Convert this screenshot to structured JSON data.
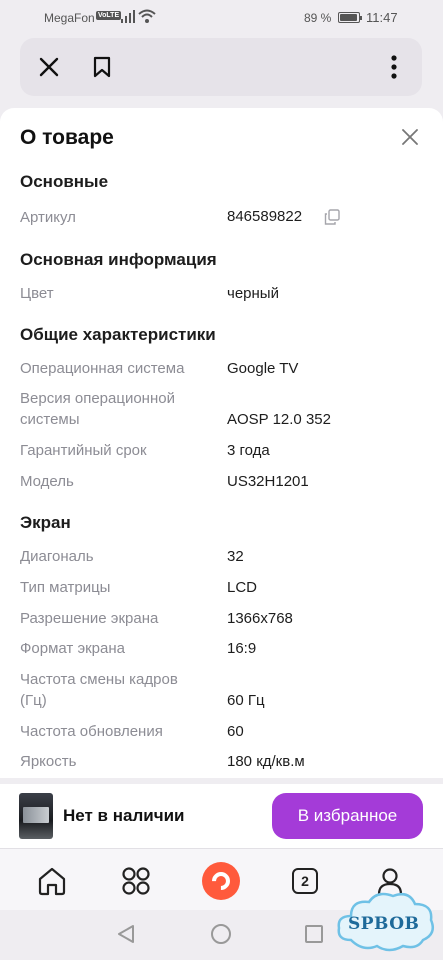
{
  "status_bar": {
    "carrier": "MegaFon",
    "volte": "VoLTE",
    "battery": "89 %",
    "time": "11:47"
  },
  "sheet": {
    "title": "О товаре",
    "sections": {
      "main": {
        "title": "Основные",
        "article_label": "Артикул",
        "article_value": "846589822"
      },
      "basic_info": {
        "title": "Основная информация",
        "color_label": "Цвет",
        "color_value": "черный"
      },
      "general": {
        "title": "Общие характеристики",
        "os_label": "Операционная система",
        "os_value": "Google TV",
        "os_version_label_1": "Версия операционной",
        "os_version_label_2": "системы",
        "os_version_value": "AOSP 12.0 352",
        "warranty_label": "Гарантийный срок",
        "warranty_value": "3 года",
        "model_label": "Модель",
        "model_value": "US32H1201"
      },
      "screen": {
        "title": "Экран",
        "diagonal_label": "Диагональ",
        "diagonal_value": "32",
        "matrix_label": "Тип матрицы",
        "matrix_value": "LCD",
        "resolution_label": "Разрешение экрана",
        "resolution_value": "1366x768",
        "format_label": "Формат экрана",
        "format_value": "16:9",
        "framerate_label_1": "Частота смены кадров",
        "framerate_label_2": "(Гц)",
        "framerate_value": "60 Гц",
        "refresh_label": "Частота обновления",
        "refresh_value": "60",
        "brightness_label": "Яркость",
        "brightness_value": "180 кд/кв.м"
      }
    }
  },
  "bottom_card": {
    "stock_status": "Нет в наличии",
    "favorite_label": "В избранное"
  },
  "tab_bar": {
    "tabs_count": "2"
  },
  "watermark": {
    "text": "SPBOB"
  },
  "colors": {
    "accent": "#a43bd8",
    "alice": "#ff5a3c",
    "label_gray": "#8c8c94"
  }
}
